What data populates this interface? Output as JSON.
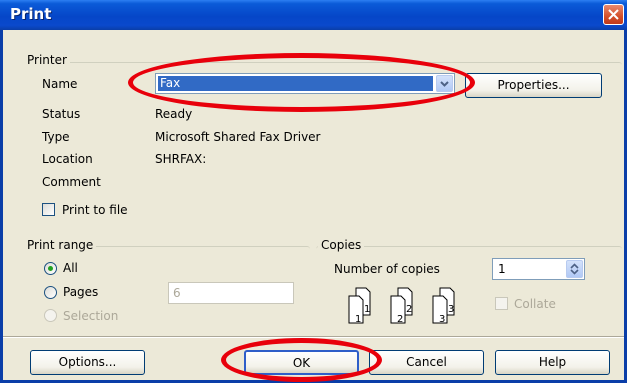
{
  "window": {
    "title": "Print",
    "close_icon": "close-icon"
  },
  "printer": {
    "group_label": "Printer",
    "name_label": "Name",
    "name_value": "Fax",
    "properties_button": "Properties...",
    "status_label": "Status",
    "status_value": "Ready",
    "type_label": "Type",
    "type_value": "Microsoft Shared Fax Driver",
    "location_label": "Location",
    "location_value": "SHRFAX:",
    "comment_label": "Comment",
    "comment_value": "",
    "print_to_file_label": "Print to file",
    "print_to_file_checked": false
  },
  "print_range": {
    "group_label": "Print range",
    "all_label": "All",
    "pages_label": "Pages",
    "pages_value": "6",
    "selection_label": "Selection",
    "selected": "All"
  },
  "copies": {
    "group_label": "Copies",
    "number_label": "Number of copies",
    "number_value": "1",
    "collate_label": "Collate",
    "collate_checked": false,
    "page_icons": [
      {
        "back": "1",
        "front": "1"
      },
      {
        "back": "2",
        "front": "2"
      },
      {
        "back": "3",
        "front": "3"
      }
    ]
  },
  "buttons": {
    "options": "Options...",
    "ok": "OK",
    "cancel": "Cancel",
    "help": "Help"
  },
  "colors": {
    "annotation": "#e8000b",
    "title_bar": "#0546c8",
    "dialog_bg": "#ece9d8"
  }
}
